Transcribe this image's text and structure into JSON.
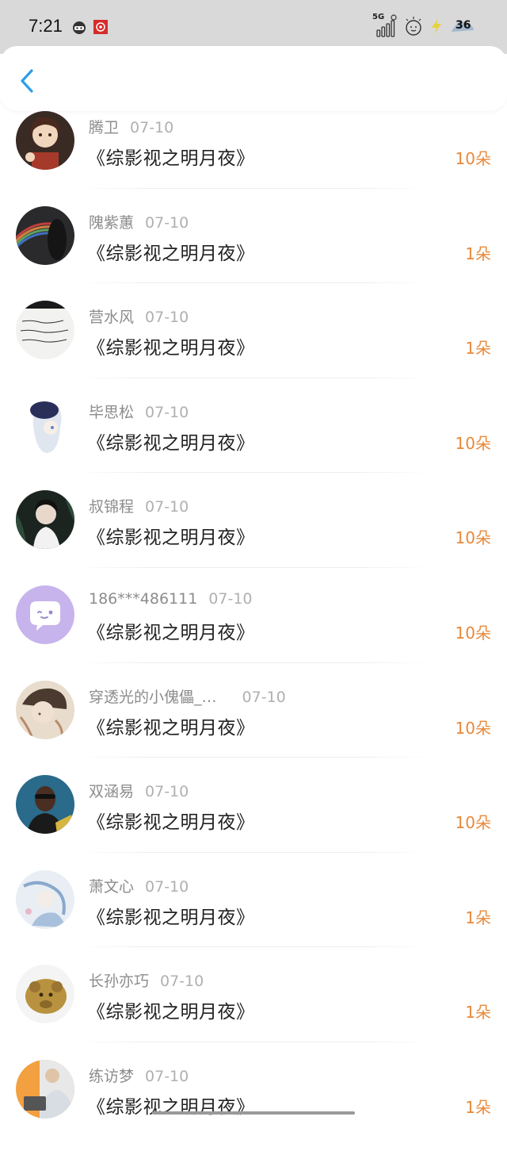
{
  "status_bar": {
    "time": "7:21",
    "network": "5G",
    "battery": "36"
  },
  "header": {
    "back_icon": "chevron-left-icon"
  },
  "colors": {
    "accent_back": "#2d9ee8",
    "amount": "#e8893a"
  },
  "items": [
    {
      "name": "腾卫",
      "date": "07-10",
      "title": "《综影视之明月夜》",
      "amount": "10朵"
    },
    {
      "name": "隗紫蕙",
      "date": "07-10",
      "title": "《综影视之明月夜》",
      "amount": "1朵"
    },
    {
      "name": "营水风",
      "date": "07-10",
      "title": "《综影视之明月夜》",
      "amount": "1朵"
    },
    {
      "name": "毕思松",
      "date": "07-10",
      "title": "《综影视之明月夜》",
      "amount": "10朵"
    },
    {
      "name": "叔锦程",
      "date": "07-10",
      "title": "《综影视之明月夜》",
      "amount": "10朵"
    },
    {
      "name": "186***486111",
      "date": "07-10",
      "title": "《综影视之明月夜》",
      "amount": "10朵"
    },
    {
      "name": "穿透光的小傀儡_…",
      "date": "07-10",
      "title": "《综影视之明月夜》",
      "amount": "10朵"
    },
    {
      "name": "双涵易",
      "date": "07-10",
      "title": "《综影视之明月夜》",
      "amount": "10朵"
    },
    {
      "name": "萧文心",
      "date": "07-10",
      "title": "《综影视之明月夜》",
      "amount": "1朵"
    },
    {
      "name": "长孙亦巧",
      "date": "07-10",
      "title": "《综影视之明月夜》",
      "amount": "1朵"
    },
    {
      "name": "练访梦",
      "date": "07-10",
      "title": "《综影视之明月夜》",
      "amount": "1朵"
    }
  ]
}
